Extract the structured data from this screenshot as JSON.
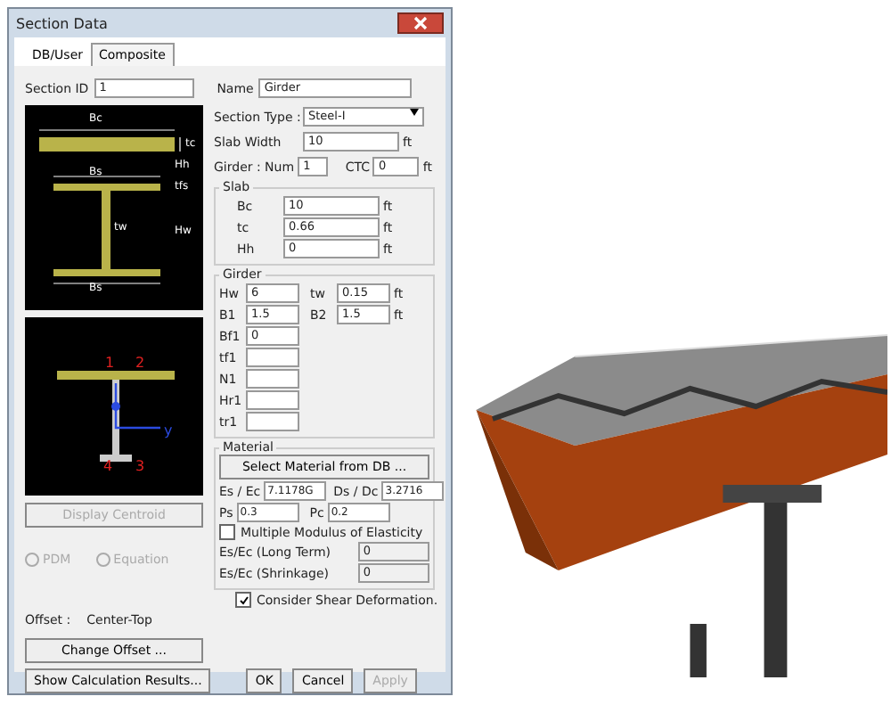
{
  "window": {
    "title": "Section Data"
  },
  "tabs": [
    {
      "label": "DB/User",
      "selected": false
    },
    {
      "label": "Composite",
      "selected": true
    }
  ],
  "section_id": {
    "label": "Section ID",
    "value": "1"
  },
  "name": {
    "label": "Name",
    "value": "Girder"
  },
  "section_type": {
    "label": "Section Type :",
    "value": "Steel-I"
  },
  "slab_width": {
    "label": "Slab Width",
    "value": "10",
    "unit": "ft"
  },
  "girder_num": {
    "label": "Girder : Num",
    "value": "1"
  },
  "ctc": {
    "label": "CTC",
    "value": "0",
    "unit": "ft"
  },
  "slab": {
    "title": "Slab",
    "fields": [
      {
        "label": "Bc",
        "value": "10",
        "unit": "ft"
      },
      {
        "label": "tc",
        "value": "0.66",
        "unit": "ft"
      },
      {
        "label": "Hh",
        "value": "0",
        "unit": "ft"
      }
    ]
  },
  "girder": {
    "title": "Girder",
    "rows": [
      [
        {
          "label": "Hw",
          "value": "6"
        },
        {
          "label": "tw",
          "value": "0.15",
          "unit": "ft"
        }
      ],
      [
        {
          "label": "B1",
          "value": "1.5"
        },
        {
          "label": "B2",
          "value": "1.5",
          "unit": "ft"
        }
      ],
      [
        {
          "label": "Bf1",
          "value": "0"
        }
      ],
      [
        {
          "label": "tf1"
        }
      ],
      [
        {
          "label": "N1"
        }
      ],
      [
        {
          "label": "Hr1"
        }
      ],
      [
        {
          "label": "tr1"
        }
      ]
    ]
  },
  "diagram_top": {
    "labels": [
      "Bc",
      "tc",
      "Hh",
      "Bs",
      "tfs",
      "tw",
      "Hw",
      "Bs"
    ]
  },
  "diagram_bottom": {
    "labels": [
      "1",
      "2",
      "y",
      "4",
      "3"
    ]
  },
  "display_centroid": {
    "label": "Display Centroid",
    "disabled": true
  },
  "radios": [
    {
      "label": "PDM",
      "selected": false,
      "disabled": true
    },
    {
      "label": "Equation",
      "selected": false,
      "disabled": true
    }
  ],
  "offset": {
    "label": "Offset :",
    "value": "Center-Top"
  },
  "change_offset": "Change Offset ...",
  "material": {
    "title": "Material",
    "button": "Select Material from DB ...",
    "pairs": [
      [
        {
          "label": "Es / Ec",
          "value": "7.1178G"
        },
        {
          "label": "Ds / Dc",
          "value": "3.2716"
        }
      ],
      [
        {
          "label": "Ps",
          "value": "0.3"
        },
        {
          "label": "Pc",
          "value": "0.2"
        }
      ]
    ],
    "multiple": {
      "label": "Multiple Modulus of Elasticity",
      "checked": false
    },
    "extra": [
      {
        "label": "Es/Ec (Long Term)",
        "value": "0"
      },
      {
        "label": "Es/Ec (Shrinkage)",
        "value": "0"
      }
    ]
  },
  "shear": {
    "label": "Consider Shear Deformation.",
    "checked": true
  },
  "buttons": [
    {
      "label": "Show Calculation Results...",
      "disabled": false
    },
    {
      "label": "OK",
      "disabled": false
    },
    {
      "label": "Cancel",
      "disabled": false
    },
    {
      "label": "Apply",
      "disabled": true
    }
  ]
}
